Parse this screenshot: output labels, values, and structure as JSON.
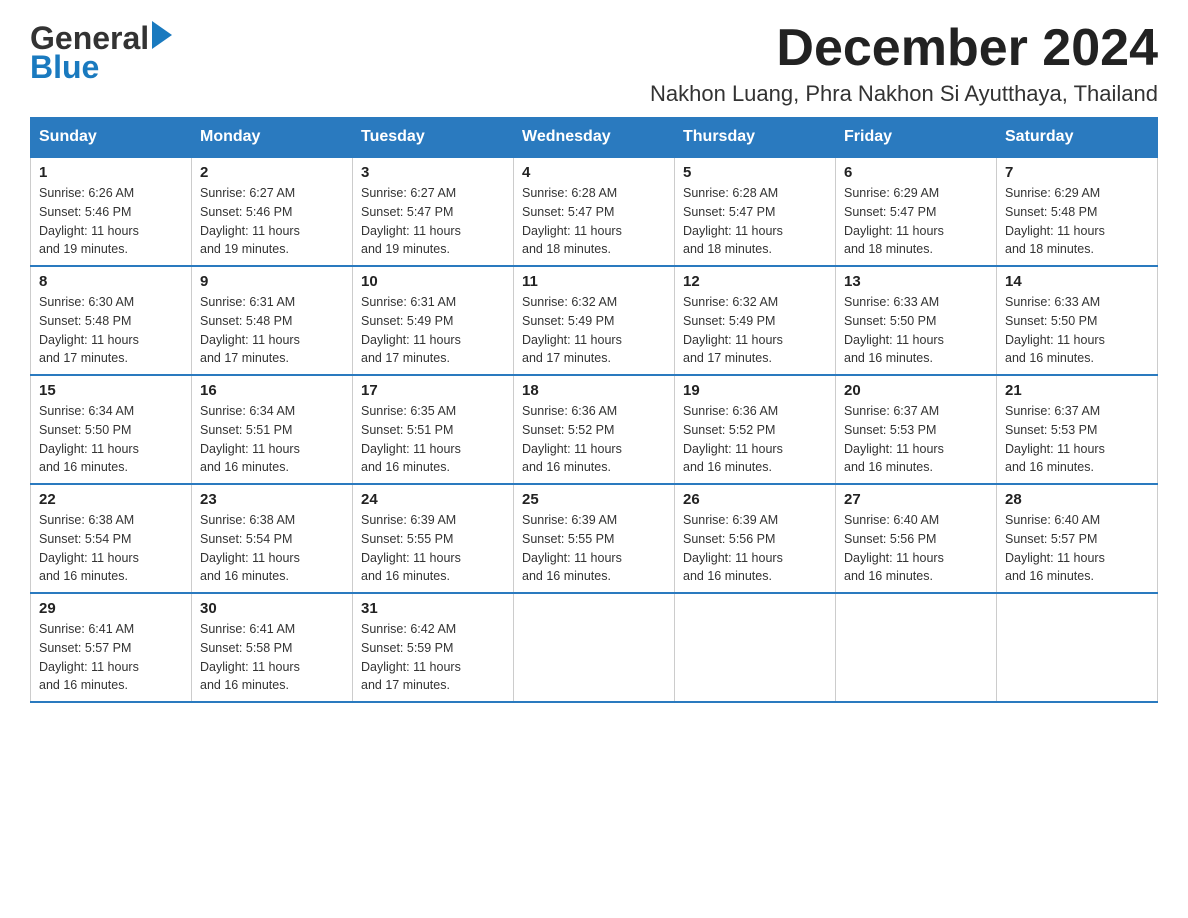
{
  "header": {
    "logo_general": "General",
    "logo_blue": "Blue",
    "main_title": "December 2024",
    "subtitle": "Nakhon Luang, Phra Nakhon Si Ayutthaya, Thailand"
  },
  "days_of_week": [
    "Sunday",
    "Monday",
    "Tuesday",
    "Wednesday",
    "Thursday",
    "Friday",
    "Saturday"
  ],
  "weeks": [
    [
      {
        "day": "1",
        "info": "Sunrise: 6:26 AM\nSunset: 5:46 PM\nDaylight: 11 hours\nand 19 minutes."
      },
      {
        "day": "2",
        "info": "Sunrise: 6:27 AM\nSunset: 5:46 PM\nDaylight: 11 hours\nand 19 minutes."
      },
      {
        "day": "3",
        "info": "Sunrise: 6:27 AM\nSunset: 5:47 PM\nDaylight: 11 hours\nand 19 minutes."
      },
      {
        "day": "4",
        "info": "Sunrise: 6:28 AM\nSunset: 5:47 PM\nDaylight: 11 hours\nand 18 minutes."
      },
      {
        "day": "5",
        "info": "Sunrise: 6:28 AM\nSunset: 5:47 PM\nDaylight: 11 hours\nand 18 minutes."
      },
      {
        "day": "6",
        "info": "Sunrise: 6:29 AM\nSunset: 5:47 PM\nDaylight: 11 hours\nand 18 minutes."
      },
      {
        "day": "7",
        "info": "Sunrise: 6:29 AM\nSunset: 5:48 PM\nDaylight: 11 hours\nand 18 minutes."
      }
    ],
    [
      {
        "day": "8",
        "info": "Sunrise: 6:30 AM\nSunset: 5:48 PM\nDaylight: 11 hours\nand 17 minutes."
      },
      {
        "day": "9",
        "info": "Sunrise: 6:31 AM\nSunset: 5:48 PM\nDaylight: 11 hours\nand 17 minutes."
      },
      {
        "day": "10",
        "info": "Sunrise: 6:31 AM\nSunset: 5:49 PM\nDaylight: 11 hours\nand 17 minutes."
      },
      {
        "day": "11",
        "info": "Sunrise: 6:32 AM\nSunset: 5:49 PM\nDaylight: 11 hours\nand 17 minutes."
      },
      {
        "day": "12",
        "info": "Sunrise: 6:32 AM\nSunset: 5:49 PM\nDaylight: 11 hours\nand 17 minutes."
      },
      {
        "day": "13",
        "info": "Sunrise: 6:33 AM\nSunset: 5:50 PM\nDaylight: 11 hours\nand 16 minutes."
      },
      {
        "day": "14",
        "info": "Sunrise: 6:33 AM\nSunset: 5:50 PM\nDaylight: 11 hours\nand 16 minutes."
      }
    ],
    [
      {
        "day": "15",
        "info": "Sunrise: 6:34 AM\nSunset: 5:50 PM\nDaylight: 11 hours\nand 16 minutes."
      },
      {
        "day": "16",
        "info": "Sunrise: 6:34 AM\nSunset: 5:51 PM\nDaylight: 11 hours\nand 16 minutes."
      },
      {
        "day": "17",
        "info": "Sunrise: 6:35 AM\nSunset: 5:51 PM\nDaylight: 11 hours\nand 16 minutes."
      },
      {
        "day": "18",
        "info": "Sunrise: 6:36 AM\nSunset: 5:52 PM\nDaylight: 11 hours\nand 16 minutes."
      },
      {
        "day": "19",
        "info": "Sunrise: 6:36 AM\nSunset: 5:52 PM\nDaylight: 11 hours\nand 16 minutes."
      },
      {
        "day": "20",
        "info": "Sunrise: 6:37 AM\nSunset: 5:53 PM\nDaylight: 11 hours\nand 16 minutes."
      },
      {
        "day": "21",
        "info": "Sunrise: 6:37 AM\nSunset: 5:53 PM\nDaylight: 11 hours\nand 16 minutes."
      }
    ],
    [
      {
        "day": "22",
        "info": "Sunrise: 6:38 AM\nSunset: 5:54 PM\nDaylight: 11 hours\nand 16 minutes."
      },
      {
        "day": "23",
        "info": "Sunrise: 6:38 AM\nSunset: 5:54 PM\nDaylight: 11 hours\nand 16 minutes."
      },
      {
        "day": "24",
        "info": "Sunrise: 6:39 AM\nSunset: 5:55 PM\nDaylight: 11 hours\nand 16 minutes."
      },
      {
        "day": "25",
        "info": "Sunrise: 6:39 AM\nSunset: 5:55 PM\nDaylight: 11 hours\nand 16 minutes."
      },
      {
        "day": "26",
        "info": "Sunrise: 6:39 AM\nSunset: 5:56 PM\nDaylight: 11 hours\nand 16 minutes."
      },
      {
        "day": "27",
        "info": "Sunrise: 6:40 AM\nSunset: 5:56 PM\nDaylight: 11 hours\nand 16 minutes."
      },
      {
        "day": "28",
        "info": "Sunrise: 6:40 AM\nSunset: 5:57 PM\nDaylight: 11 hours\nand 16 minutes."
      }
    ],
    [
      {
        "day": "29",
        "info": "Sunrise: 6:41 AM\nSunset: 5:57 PM\nDaylight: 11 hours\nand 16 minutes."
      },
      {
        "day": "30",
        "info": "Sunrise: 6:41 AM\nSunset: 5:58 PM\nDaylight: 11 hours\nand 16 minutes."
      },
      {
        "day": "31",
        "info": "Sunrise: 6:42 AM\nSunset: 5:59 PM\nDaylight: 11 hours\nand 17 minutes."
      },
      {
        "day": "",
        "info": ""
      },
      {
        "day": "",
        "info": ""
      },
      {
        "day": "",
        "info": ""
      },
      {
        "day": "",
        "info": ""
      }
    ]
  ]
}
